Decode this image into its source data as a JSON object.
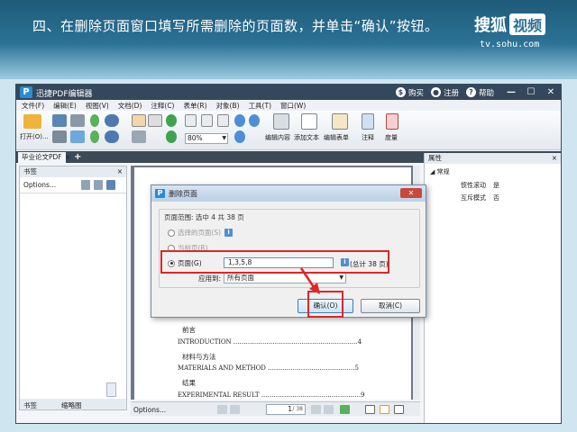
{
  "banner": {
    "instruction": "四、在删除页面窗口填写所需删除的页面数，并单击“确认”按钮。",
    "logo_text": "搜狐",
    "logo_box": "视频",
    "logo_url": "tv.sohu.com"
  },
  "app": {
    "icon_letter": "P",
    "title": "迅捷PDF编辑器",
    "buy": "购买",
    "register": "注册",
    "help": "帮助",
    "controls": [
      "—",
      "☐",
      "✕"
    ]
  },
  "menu": [
    "文件(F)",
    "编辑(E)",
    "视图(V)",
    "文档(D)",
    "注释(C)",
    "表单(R)",
    "对象(B)",
    "工具(T)",
    "窗口(W)"
  ],
  "toolbar": {
    "open_label": "打开(O)...",
    "zoom": "80%",
    "edit_content": "编辑内容",
    "add_text": "添加文本",
    "edit_form": "编辑表单",
    "annotate": "注释",
    "measure": "度量"
  },
  "tabs": {
    "doc_tab": "毕业论文PDF",
    "doc_tab_close": "×",
    "add": "+",
    "close": "×"
  },
  "left_panel": {
    "title": "书签",
    "close": "×",
    "options": "Options...",
    "bottom_tab_bookmarks": "书签",
    "bottom_tab_thumbnails": "缩略图"
  },
  "document": {
    "toc": [
      "前言",
      "INTRODUCTION ……………………………………………………4",
      "材料与方法",
      "MATERIALS AND METHOD ……………………………………5",
      "结果",
      "EXPERIMENTAL  RESULT …………………………………………9"
    ]
  },
  "statusbar": {
    "options": "Options...",
    "page_current": "1",
    "page_total": "/ 38"
  },
  "right_panel": {
    "title": "属性",
    "close": "×",
    "section": "常规",
    "row1_key": "惯性滚动",
    "row1_val": "是",
    "row2_key": "互斥模式",
    "row2_val": "否"
  },
  "dialog": {
    "icon_letter": "P",
    "title": "删除页面",
    "close": "✕",
    "range_label": "页面范围: 选中 4 共 38 页",
    "opt_selected": "选择的页面(S)",
    "opt_current": "当前页(R)",
    "opt_pages": "页面(G)",
    "pages_value": "1,3,5,8",
    "pages_total": "(总计 38 页)",
    "apply_label": "应用到:",
    "apply_value": "所有页面",
    "ok": "确认(O)",
    "cancel": "取消(C)"
  },
  "colors": {
    "highlight": "#e02626",
    "titlebar": "#35475a",
    "banner": "#2b7295"
  }
}
